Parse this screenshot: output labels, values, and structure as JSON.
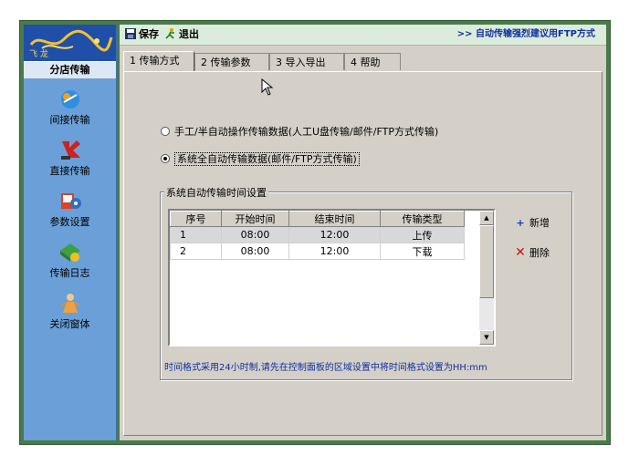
{
  "sidebar": {
    "logo_text": "飞 龙",
    "header": "分店传输",
    "items": [
      {
        "label": "间接传输",
        "icon": "indirect-transfer-icon"
      },
      {
        "label": "直接传输",
        "icon": "direct-transfer-icon"
      },
      {
        "label": "参数设置",
        "icon": "settings-icon"
      },
      {
        "label": "传输日志",
        "icon": "log-icon"
      },
      {
        "label": "关闭窗体",
        "icon": "close-window-icon"
      }
    ]
  },
  "toolbar": {
    "save_label": "保存",
    "exit_label": "退出",
    "hint": ">> 自动传输强烈建议用FTP方式"
  },
  "tabs": [
    {
      "label": "1 传输方式",
      "active": true
    },
    {
      "label": "2 传输参数",
      "active": false
    },
    {
      "label": "3 导入导出",
      "active": false
    },
    {
      "label": "4 帮助",
      "active": false
    }
  ],
  "options": {
    "manual": "手工/半自动操作传输数据(人工U盘传输/邮件/FTP方式传输)",
    "auto": "系统全自动传输数据(邮件/FTP方式传输)",
    "selected": "auto"
  },
  "schedule": {
    "title": "系统自动传输时间设置",
    "columns": [
      "序号",
      "开始时间",
      "结束时间",
      "传输类型"
    ],
    "rows": [
      [
        "1",
        "08:00",
        "12:00",
        "上传"
      ],
      [
        "2",
        "08:00",
        "12:00",
        "下载"
      ]
    ],
    "add_label": "新增",
    "delete_label": "删除",
    "note": "时间格式采用24小时制,请先在控制面板的区域设置中将时间格式设置为HH:mm"
  },
  "colors": {
    "sidebar": "#6a9fd8",
    "toolbar": "#dcecdc",
    "panel": "#d4d0c8",
    "accent_text": "#1030a0"
  }
}
